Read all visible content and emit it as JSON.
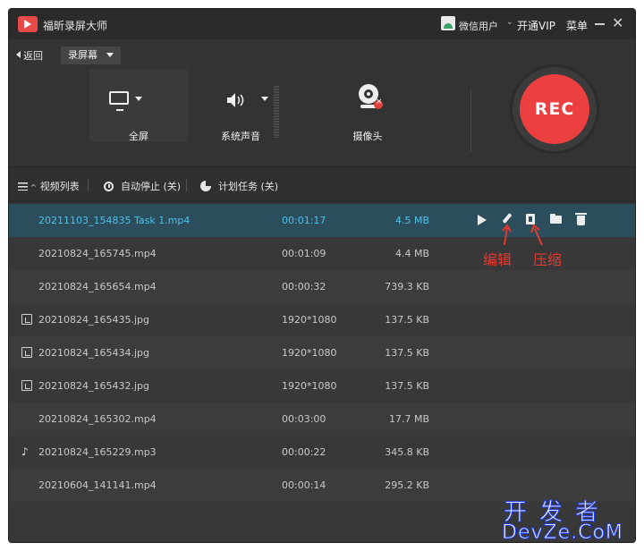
{
  "window": {
    "app_title": "福昕录屏大师",
    "user_name": "微信用户",
    "vip_link": "开通VIP",
    "menu_label": "菜单",
    "minimize_symbol": "—",
    "close_symbol": "✕"
  },
  "toolbar": {
    "back_label": "返回",
    "mode_label": "录屏幕"
  },
  "sources": {
    "screen_label": "全屏",
    "sound_label": "系统声音",
    "camera_label": "摄像头"
  },
  "record": {
    "label": "REC",
    "color": "#ec3f40"
  },
  "tabs": {
    "list_label": "视频列表",
    "autostop_label": "自动停止 (关)",
    "schedule_label": "计划任务 (关)"
  },
  "files": [
    {
      "name": "20211103_154835 Task 1.mp4",
      "duration": "00:01:17",
      "size": "4.5 MB",
      "type": "video",
      "selected": true
    },
    {
      "name": "20210824_165745.mp4",
      "duration": "00:01:09",
      "size": "4.4 MB",
      "type": "video"
    },
    {
      "name": "20210824_165654.mp4",
      "duration": "00:00:32",
      "size": "739.3 KB",
      "type": "video"
    },
    {
      "name": "20210824_165435.jpg",
      "duration": "1920*1080",
      "size": "137.5 KB",
      "type": "image"
    },
    {
      "name": "20210824_165434.jpg",
      "duration": "1920*1080",
      "size": "137.5 KB",
      "type": "image"
    },
    {
      "name": "20210824_165432.jpg",
      "duration": "1920*1080",
      "size": "137.5 KB",
      "type": "image"
    },
    {
      "name": "20210824_165302.mp4",
      "duration": "00:03:00",
      "size": "17.7 MB",
      "type": "video"
    },
    {
      "name": "20210824_165229.mp3",
      "duration": "00:00:22",
      "size": "345.8 KB",
      "type": "audio"
    },
    {
      "name": "20210604_141141.mp4",
      "duration": "00:00:14",
      "size": "295.2 KB",
      "type": "video"
    }
  ],
  "annotations": {
    "edit_label": "编辑",
    "compress_label": "压缩",
    "color": "#e23a32"
  },
  "watermark": {
    "cn": "开发者",
    "en": "DevZe.CoM"
  }
}
